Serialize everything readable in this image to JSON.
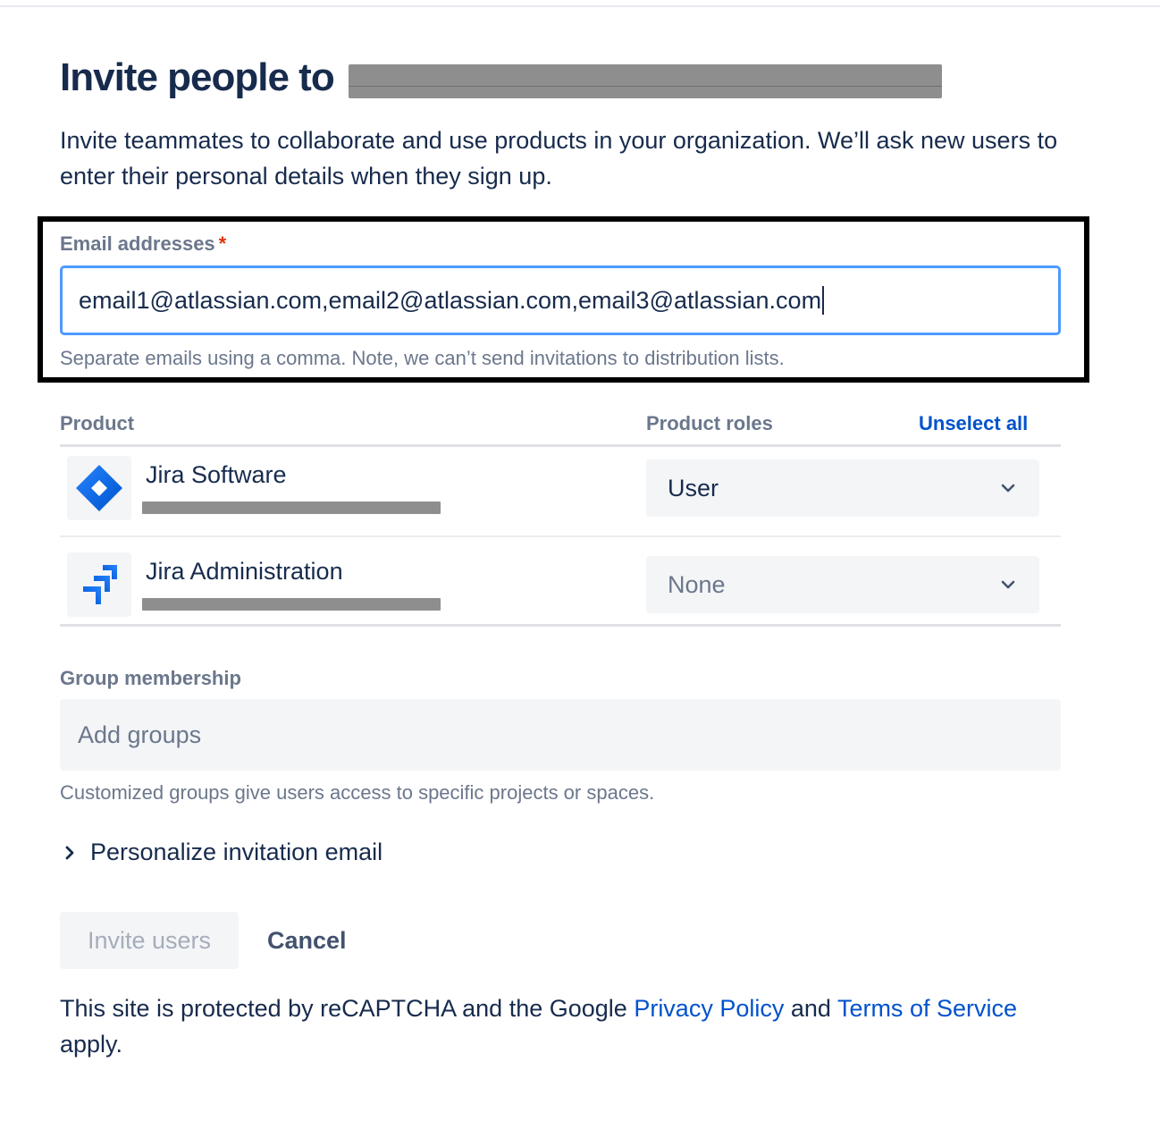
{
  "header": {
    "title": "Invite people to"
  },
  "description": "Invite teammates to collaborate and use products in your organization. We’ll ask new users to enter their personal details when they sign up.",
  "email_field": {
    "label": "Email addresses",
    "required_mark": "*",
    "value": "email1@atlassian.com,email2@atlassian.com,email3@atlassian.com",
    "help": "Separate emails using a comma. Note, we can’t send invitations to distribution lists."
  },
  "products_table": {
    "col_product": "Product",
    "col_roles": "Product roles",
    "unselect_all": "Unselect all",
    "rows": [
      {
        "name": "Jira Software",
        "icon": "jira-software-icon",
        "role": "User"
      },
      {
        "name": "Jira Administration",
        "icon": "jira-administration-icon",
        "role": "None"
      }
    ]
  },
  "groups": {
    "label": "Group membership",
    "placeholder": "Add groups",
    "help": "Customized groups give users access to specific projects or spaces."
  },
  "personalize": {
    "label": "Personalize invitation email"
  },
  "actions": {
    "invite": "Invite users",
    "cancel": "Cancel"
  },
  "footer": {
    "text_before": "This site is protected by reCAPTCHA and the Google ",
    "privacy_link": "Privacy Policy",
    "text_mid": " and ",
    "terms_link": "Terms of Service",
    "text_after": " apply."
  },
  "colors": {
    "accent": "#0052cc",
    "focus_border": "#4c9aff",
    "required": "#de350b",
    "text": "#172b4d",
    "muted": "#6b778c"
  }
}
